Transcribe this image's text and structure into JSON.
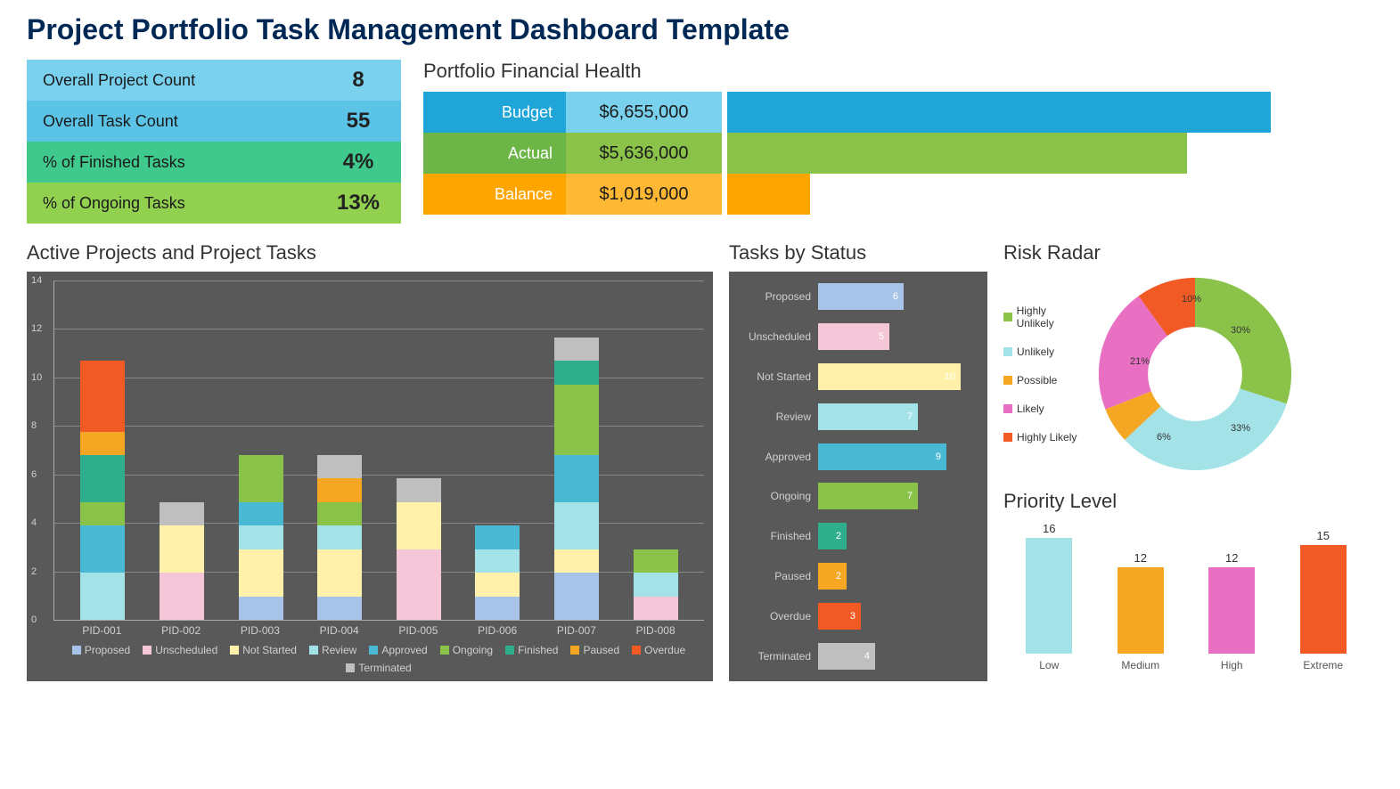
{
  "title": "Project Portfolio Task Management Dashboard Template",
  "summary": [
    {
      "label": "Overall Project Count",
      "value": "8",
      "cls": "c-lightblue"
    },
    {
      "label": "Overall Task Count",
      "value": "55",
      "cls": "c-blue"
    },
    {
      "label": "% of Finished Tasks",
      "value": "4%",
      "cls": "c-green"
    },
    {
      "label": "% of Ongoing Tasks",
      "value": "13%",
      "cls": "c-lime"
    }
  ],
  "financial": {
    "title": "Portfolio Financial Health",
    "rows": [
      {
        "label": "Budget",
        "value": "$6,655,000",
        "cls": "fb-blue"
      },
      {
        "label": "Actual",
        "value": "$5,636,000",
        "cls": "fb-green"
      },
      {
        "label": "Balance",
        "value": "$1,019,000",
        "cls": "fb-orange"
      }
    ]
  },
  "stacked": {
    "title": "Active Projects and Project Tasks",
    "yticks": [
      0,
      2,
      4,
      6,
      8,
      10,
      12,
      14
    ],
    "ymax": 14,
    "legend": [
      {
        "name": "Proposed",
        "cls": "col-proposed"
      },
      {
        "name": "Unscheduled",
        "cls": "col-unsched"
      },
      {
        "name": "Not Started",
        "cls": "col-notstart"
      },
      {
        "name": "Review",
        "cls": "col-review"
      },
      {
        "name": "Approved",
        "cls": "col-approved"
      },
      {
        "name": "Ongoing",
        "cls": "col-ongoing"
      },
      {
        "name": "Finished",
        "cls": "col-finished"
      },
      {
        "name": "Paused",
        "cls": "col-paused"
      },
      {
        "name": "Overdue",
        "cls": "col-overdue"
      },
      {
        "name": "Terminated",
        "cls": "col-term"
      }
    ]
  },
  "status": {
    "title": "Tasks by Status"
  },
  "risk": {
    "title": "Risk Radar",
    "legend": [
      {
        "name": "Highly Unlikely",
        "cls": "col-hu"
      },
      {
        "name": "Unlikely",
        "cls": "col-u"
      },
      {
        "name": "Possible",
        "cls": "col-p"
      },
      {
        "name": "Likely",
        "cls": "col-l"
      },
      {
        "name": "Highly Likely",
        "cls": "col-hl"
      }
    ]
  },
  "priority": {
    "title": "Priority Level"
  },
  "chart_data": {
    "stacked": {
      "type": "bar",
      "categories": [
        "PID-001",
        "PID-002",
        "PID-003",
        "PID-004",
        "PID-005",
        "PID-006",
        "PID-007",
        "PID-008"
      ],
      "ylim": [
        0,
        14
      ],
      "series_order": [
        "Proposed",
        "Unscheduled",
        "Not Started",
        "Review",
        "Approved",
        "Ongoing",
        "Finished",
        "Paused",
        "Overdue",
        "Terminated"
      ],
      "stacks": [
        {
          "Review": 2,
          "Approved": 2,
          "Ongoing": 1,
          "Finished": 2,
          "Paused": 1,
          "Overdue": 3
        },
        {
          "Unscheduled": 2,
          "Not Started": 2,
          "Terminated": 1
        },
        {
          "Proposed": 1,
          "Not Started": 2,
          "Review": 1,
          "Approved": 1,
          "Ongoing": 2
        },
        {
          "Proposed": 1,
          "Not Started": 2,
          "Review": 1,
          "Ongoing": 1,
          "Paused": 1,
          "Terminated": 1
        },
        {
          "Unscheduled": 3,
          "Not Started": 2,
          "Terminated": 1
        },
        {
          "Proposed": 1,
          "Not Started": 1,
          "Review": 1,
          "Approved": 1
        },
        {
          "Proposed": 2,
          "Not Started": 1,
          "Review": 2,
          "Approved": 2,
          "Ongoing": 3,
          "Finished": 1,
          "Terminated": 1
        },
        {
          "Unscheduled": 1,
          "Review": 1,
          "Ongoing": 1
        }
      ]
    },
    "status": {
      "type": "bar",
      "orientation": "horizontal",
      "items": [
        {
          "name": "Proposed",
          "value": 6,
          "cls": "col-proposed"
        },
        {
          "name": "Unscheduled",
          "value": 5,
          "cls": "col-unsched"
        },
        {
          "name": "Not Started",
          "value": 10,
          "cls": "col-notstart"
        },
        {
          "name": "Review",
          "value": 7,
          "cls": "col-review"
        },
        {
          "name": "Approved",
          "value": 9,
          "cls": "col-approved"
        },
        {
          "name": "Ongoing",
          "value": 7,
          "cls": "col-ongoing"
        },
        {
          "name": "Finished",
          "value": 2,
          "cls": "col-finished"
        },
        {
          "name": "Paused",
          "value": 2,
          "cls": "col-paused"
        },
        {
          "name": "Overdue",
          "value": 3,
          "cls": "col-overdue"
        },
        {
          "name": "Terminated",
          "value": 4,
          "cls": "col-term"
        }
      ]
    },
    "risk": {
      "type": "pie",
      "slices": [
        {
          "name": "Highly Unlikely",
          "value": 30,
          "color": "#8BC34A"
        },
        {
          "name": "Unlikely",
          "value": 33,
          "color": "#A3E3E8"
        },
        {
          "name": "Possible",
          "value": 6,
          "color": "#F5A623"
        },
        {
          "name": "Likely",
          "value": 21,
          "color": "#E86FC1"
        },
        {
          "name": "Highly Likely",
          "value": 10,
          "color": "#F15A24"
        }
      ]
    },
    "priority": {
      "type": "bar",
      "items": [
        {
          "name": "Low",
          "value": 16,
          "cls": "col-low"
        },
        {
          "name": "Medium",
          "value": 12,
          "cls": "col-med"
        },
        {
          "name": "High",
          "value": 12,
          "cls": "col-high"
        },
        {
          "name": "Extreme",
          "value": 15,
          "cls": "col-ext"
        }
      ],
      "ymax": 16
    }
  }
}
